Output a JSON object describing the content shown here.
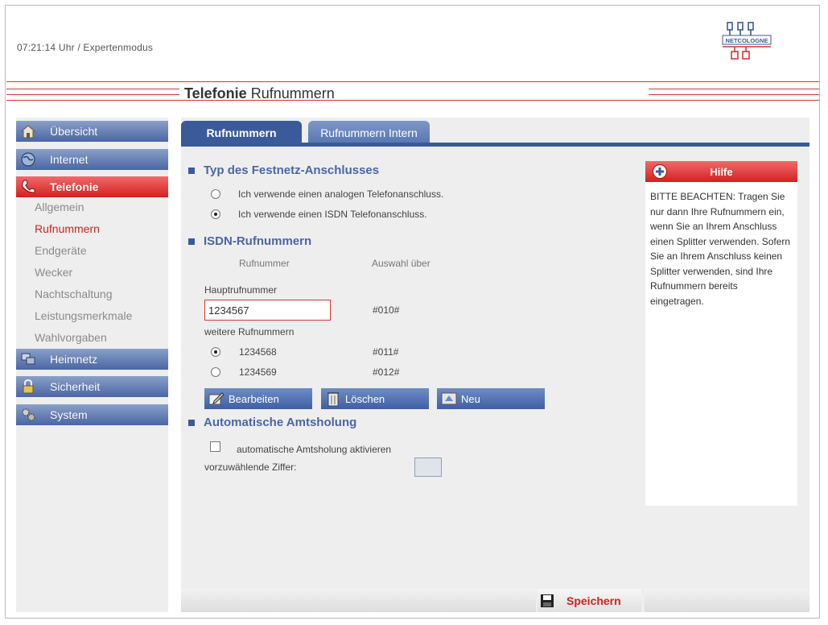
{
  "header": {
    "status": "07:21:14 Uhr / Expertenmodus",
    "logo_text": "NETCOLOGNE"
  },
  "title": {
    "bold": "Telefonie",
    "rest": " Rufnummern"
  },
  "sidebar": {
    "items": [
      {
        "label": "Übersicht",
        "icon": "home-icon"
      },
      {
        "label": "Internet",
        "icon": "globe-icon"
      },
      {
        "label": "Telefonie",
        "icon": "phone-icon",
        "active": true
      },
      {
        "label": "Heimnetz",
        "icon": "network-icon"
      },
      {
        "label": "Sicherheit",
        "icon": "lock-icon"
      },
      {
        "label": "System",
        "icon": "gears-icon"
      }
    ],
    "subitems": [
      {
        "label": "Allgemein"
      },
      {
        "label": "Rufnummern",
        "active": true
      },
      {
        "label": "Endgeräte"
      },
      {
        "label": "Wecker"
      },
      {
        "label": "Nachtschaltung"
      },
      {
        "label": "Leistungsmerkmale"
      },
      {
        "label": "Wahlvorgaben"
      }
    ]
  },
  "tabs": [
    {
      "label": "Rufnummern",
      "active": true
    },
    {
      "label": "Rufnummern Intern",
      "active": false
    }
  ],
  "festnetz": {
    "heading": "Typ des Festnetz-Anschlusses",
    "options": [
      {
        "label": "Ich verwende einen analogen Telefonanschluss.",
        "selected": false
      },
      {
        "label": "Ich verwende einen ISDN Telefonanschluss.",
        "selected": true
      }
    ]
  },
  "isdn": {
    "heading": "ISDN-Rufnummern",
    "col_number": "Rufnummer",
    "col_select": "Auswahl über",
    "main_label": "Hauptrufnummer",
    "main_value": "1234567",
    "main_code": "#010#",
    "more_label": "weitere Rufnummern",
    "rows": [
      {
        "number": "1234568",
        "code": "#011#",
        "selected": true
      },
      {
        "number": "1234569",
        "code": "#012#",
        "selected": false
      }
    ],
    "buttons": {
      "edit": "Bearbeiten",
      "delete": "Löschen",
      "new": "Neu"
    }
  },
  "amt": {
    "heading": "Automatische Amtsholung",
    "checkbox_label": "automatische Amtsholung aktivieren",
    "checked": false,
    "digit_label": "vorzuwählende Ziffer:",
    "digit_value": ""
  },
  "help": {
    "title": "Hilfe",
    "text": "BITTE BEACHTEN: Tragen Sie nur dann Ihre Rufnummern ein, wenn Sie an Ihrem Anschluss einen Splitter verwenden. Sofern Sie an Ihrem Anschluss keinen Splitter verwenden, sind Ihre Rufnummern bereits eingetragen."
  },
  "footer": {
    "save_label": "Speichern"
  },
  "colors": {
    "accent_blue": "#3b5a9a",
    "accent_red": "#d42020",
    "panel_bg": "#eeeeee"
  }
}
